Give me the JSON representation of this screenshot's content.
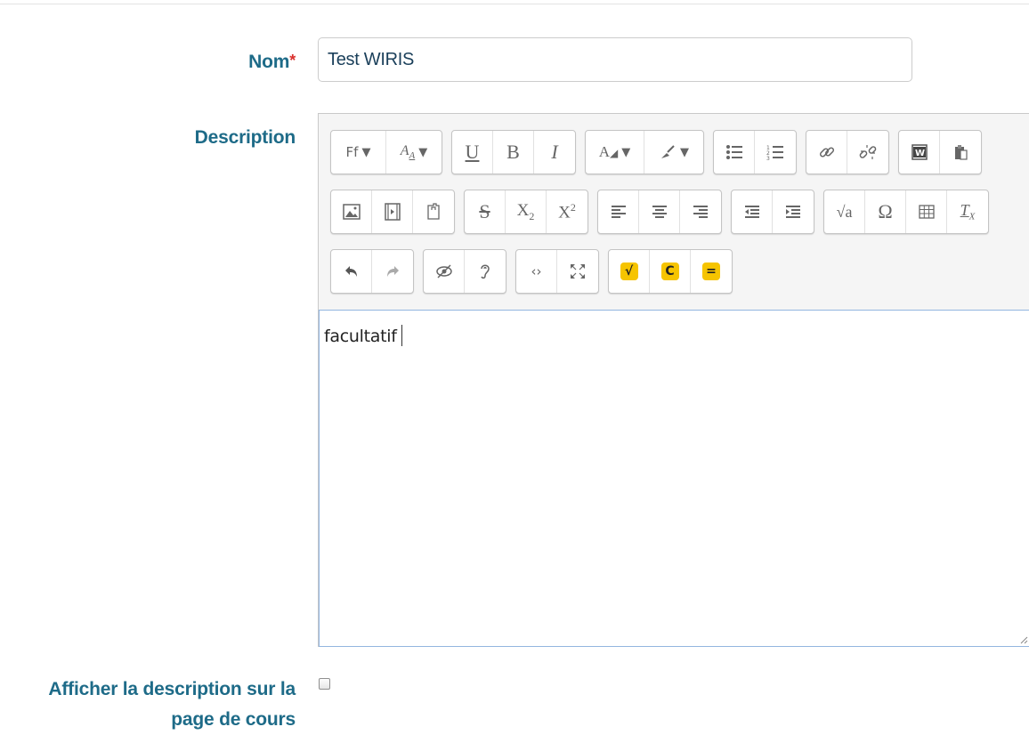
{
  "form": {
    "name_label": "Nom",
    "required_mark": "*",
    "name_value": "Test WIRIS",
    "description_label": "Description",
    "editor_text": "facultatif",
    "show_label_line1": "Afficher la description sur la",
    "show_label_line2": "page de cours",
    "show_checked": false
  },
  "toolbar": {
    "rows": [
      [
        [
          "font-family-icon",
          "font-size-icon"
        ],
        [
          "underline-icon",
          "bold-icon",
          "italic-icon"
        ],
        [
          "font-color-icon",
          "background-color-icon"
        ],
        [
          "unordered-list-icon",
          "ordered-list-icon"
        ],
        [
          "link-icon",
          "unlink-icon"
        ],
        [
          "paste-from-word-icon",
          "paste-icon"
        ]
      ],
      [
        [
          "insert-image-icon",
          "insert-media-icon",
          "manage-files-icon"
        ],
        [
          "strikethrough-icon",
          "subscript-icon",
          "superscript-icon"
        ],
        [
          "align-left-icon",
          "align-center-icon",
          "align-right-icon"
        ],
        [
          "outdent-icon",
          "indent-icon"
        ],
        [
          "equation-icon",
          "special-character-icon",
          "table-icon",
          "clear-formatting-icon"
        ]
      ],
      [
        [
          "undo-icon",
          "redo-icon"
        ],
        [
          "accessibility-checker-icon",
          "screenreader-helper-icon"
        ],
        [
          "html-source-icon",
          "fullscreen-icon"
        ],
        [
          "wiris-math-icon",
          "wiris-chem-icon",
          "wiris-calc-icon"
        ]
      ]
    ]
  }
}
